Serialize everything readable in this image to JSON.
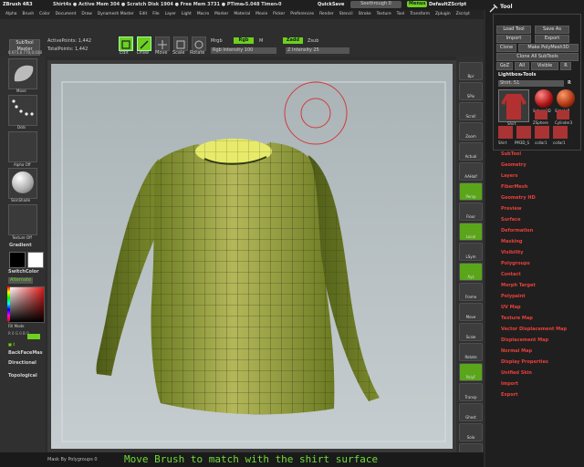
{
  "topbar": {
    "app_title": "ZBrush 4R3",
    "status_text": "Shirt4s  ● Active Mem 304 ● Scratch Disk 1904 ● Free Mem 3731 ● PTime▸5.048 Timer▸0",
    "quicksave_label": "QuickSave",
    "seethrough_label": "Seethrough  0",
    "menus_label": "Menus",
    "defaultzscript_label": "DefaultZScript"
  },
  "menubar": {
    "items": [
      "Alpha",
      "Brush",
      "Color",
      "Document",
      "Draw",
      "Dynamesh Master",
      "Edit",
      "File",
      "Layer",
      "Light",
      "Macro",
      "Marker",
      "Material",
      "Movie",
      "Picker",
      "Preferences",
      "Render",
      "Stencil",
      "Stroke",
      "Texture",
      "Tool",
      "Transform",
      "Zplugin",
      "Zscript"
    ]
  },
  "toolshelf": {
    "subtool_master": "SubTool\nMaster",
    "active_points": "ActivePoints: 1,442",
    "total_points": "TotalPoints: 1,442",
    "edit": "Edit",
    "draw": "Draw",
    "move": "Move",
    "scale": "Scale",
    "rotate": "Rotate",
    "mrgb": "Mrgb",
    "rgb": "Rgb",
    "m": "M",
    "rgb_intensity": "Rgb Intensity 100",
    "zadd": "Zadd",
    "zsub": "Zsub",
    "z_intensity": "Z Intensity 25"
  },
  "leftpanel": {
    "coords": "0.073,0.770,0.038",
    "move_label": "Move",
    "dots_label": "Dots",
    "alpha_off": "Alpha Off",
    "skinshade": "SkinShade",
    "texture_off": "Texture Off",
    "gradient": "Gradient",
    "switchcolor": "SwitchColor",
    "alternate": "Alternate",
    "fill_mode": "Fill Mode",
    "backfacemas": "BackFaceMas",
    "directional": "Directional",
    "topological": "Topological",
    "rgb_readout": "R 0 G 0 B 0"
  },
  "rightshelf": {
    "items": [
      "Bpr",
      "SPix",
      "Scroll",
      "Zoom",
      "Actual",
      "AAHalf",
      "Persp",
      "Floor",
      "Local",
      "LSym",
      "Xyz",
      "Frame",
      "Move",
      "Scale",
      "Rotate",
      "PolyF",
      "Transp",
      "Ghost",
      "Solo",
      "Xpose"
    ]
  },
  "traypanel": {
    "title": "Tool",
    "load_tool": "Load Tool",
    "save_as": "Save As",
    "import": "Import",
    "export": "Export",
    "clone": "Clone",
    "make_polymesh3d": "Make PolyMesh3D",
    "clone_all_subtools": "Clone All SubTools",
    "goz": "GoZ",
    "all": "All",
    "visible": "Visible",
    "r": "R",
    "lightbox_tools": "Lightbox▸Tools",
    "shirt_slider": "Shirt. 51",
    "thumbs": [
      "Shirt",
      "Sphere3D",
      "SimpleB",
      "Shirt",
      "ZSphere",
      "Cylinder3"
    ],
    "thumbs2": [
      "Shirt",
      "PM3D_S",
      "collar1",
      "collar1"
    ],
    "menu_items": [
      "SubTool",
      "Geometry",
      "Layers",
      "FiberMesh",
      "Geometry HD",
      "Preview",
      "Surface",
      "Deformation",
      "Masking",
      "Visibility",
      "Polygroups",
      "Contact",
      "Morph Target",
      "Polypaint",
      "UV Map",
      "Texture Map",
      "Vector Displacement Map",
      "Displacement Map",
      "Normal Map",
      "Display Properties",
      "Unified Skin",
      "Import",
      "Export"
    ]
  },
  "bottombar": {
    "mask_label": "Mask By Polygroups 0",
    "caption": "Move Brush to match with the shirt surface"
  },
  "colors": {
    "accent_green": "#6fcf1e",
    "menu_red": "#e8403a",
    "caption_green": "#6fdc3a"
  }
}
